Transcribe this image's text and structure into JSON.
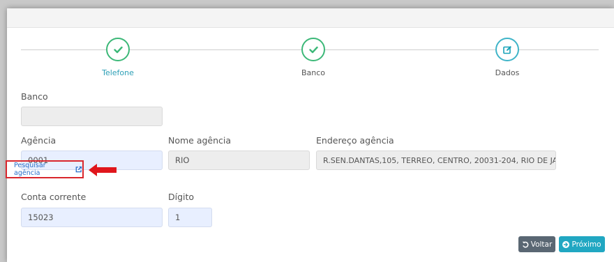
{
  "stepper": {
    "steps": [
      {
        "label": "Telefone",
        "icon": "check-icon",
        "state": "completed"
      },
      {
        "label": "Banco",
        "icon": "check-icon",
        "state": "completed"
      },
      {
        "label": "Dados",
        "icon": "edit-icon",
        "state": "current"
      }
    ]
  },
  "form": {
    "banco": {
      "label": "Banco",
      "value": ""
    },
    "agencia": {
      "label": "Agência",
      "value": "0001"
    },
    "nome_agencia": {
      "label": "Nome agência",
      "value": "RIO"
    },
    "endereco_agencia": {
      "label": "Endereço agência",
      "value": "R.SEN.DANTAS,105, TERREO, CENTRO, 20031-204, RIO DE JA"
    },
    "pesquisar_agencia": {
      "label": "Pesquisar agência",
      "icon": "external-link-icon"
    },
    "conta_corrente": {
      "label": "Conta corrente",
      "value": "15023"
    },
    "digito": {
      "label": "Dígito",
      "value": "1"
    }
  },
  "actions": {
    "voltar": {
      "label": "Voltar",
      "icon": "undo-icon"
    },
    "proximo": {
      "label": "Próximo",
      "icon": "arrow-right-circle-icon"
    }
  },
  "colors": {
    "step_done": "#3cb878",
    "step_active_label": "#2c9fb6",
    "highlight_box": "#d9262c",
    "link": "#2a6fc9",
    "btn_back": "#5a6773",
    "btn_next": "#21a7c2"
  }
}
